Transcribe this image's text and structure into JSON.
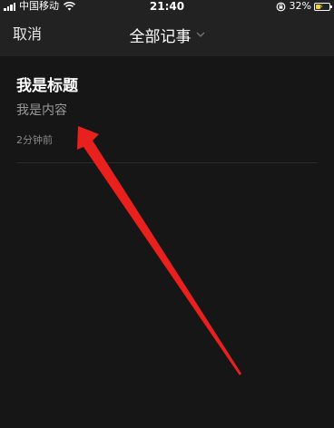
{
  "status_bar": {
    "carrier": "中国移动",
    "time": "21:40",
    "battery": "32%"
  },
  "nav": {
    "cancel_label": "取消",
    "title": "全部记事"
  },
  "notes": [
    {
      "title": "我是标题",
      "body": "我是内容",
      "time": "2分钟前"
    }
  ],
  "colors": {
    "background": "#161616",
    "bar_background": "#222222",
    "annotation_arrow": "#e8201e",
    "battery_fill": "#f4d03f"
  },
  "icons": [
    "signal-icon",
    "wifi-icon",
    "rotation-lock-icon",
    "battery-icon",
    "chevron-down-icon"
  ]
}
